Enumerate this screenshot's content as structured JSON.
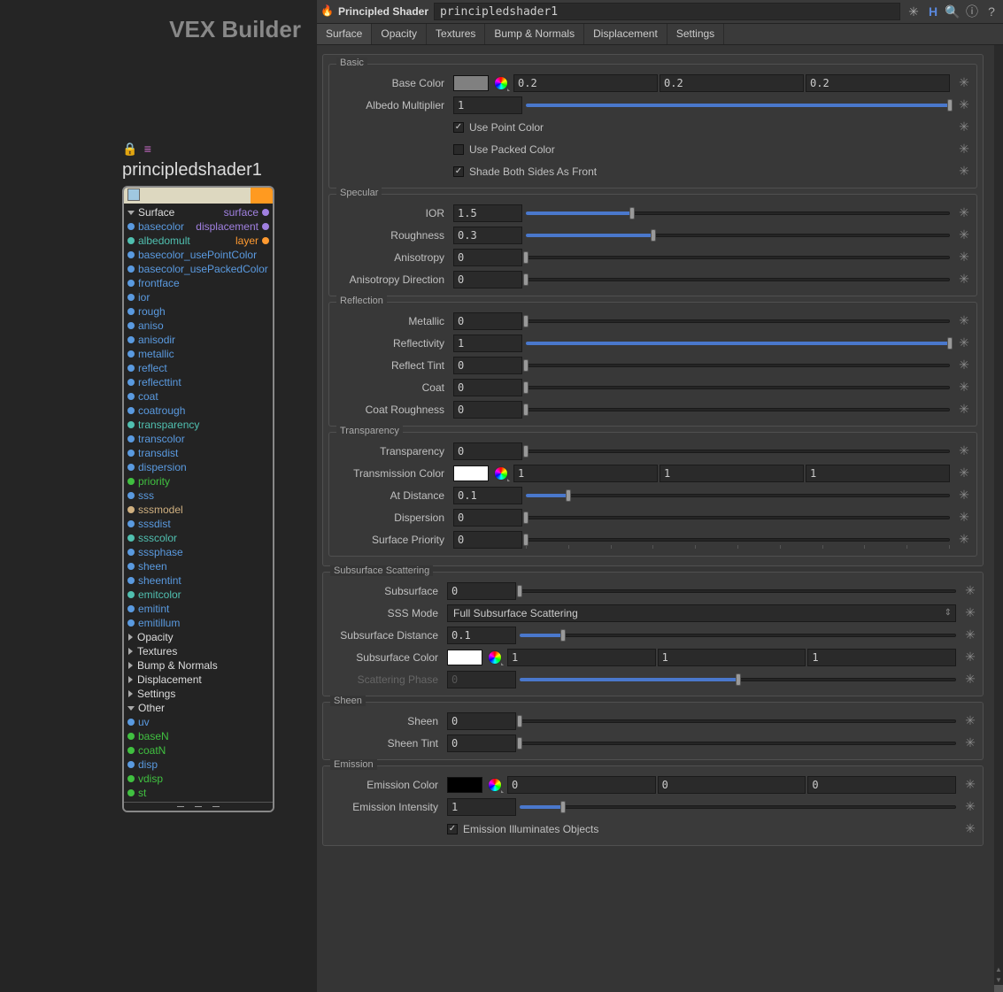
{
  "app_title": "VEX Builder",
  "node": {
    "title": "principledshader1",
    "sections": {
      "surface": "Surface",
      "opacity": "Opacity",
      "textures": "Textures",
      "bump": "Bump & Normals",
      "displacement": "Displacement",
      "settings": "Settings",
      "other": "Other"
    },
    "right_plugs": {
      "surface": "surface",
      "displacement": "displacement",
      "layer": "layer"
    },
    "params": {
      "basecolor": "basecolor",
      "albedomult": "albedomult",
      "basecolor_usePointColor": "basecolor_usePointColor",
      "basecolor_usePackedColor": "basecolor_usePackedColor",
      "frontface": "frontface",
      "ior": "ior",
      "rough": "rough",
      "aniso": "aniso",
      "anisodir": "anisodir",
      "metallic": "metallic",
      "reflect": "reflect",
      "reflecttint": "reflecttint",
      "coat": "coat",
      "coatrough": "coatrough",
      "transparency": "transparency",
      "transcolor": "transcolor",
      "transdist": "transdist",
      "dispersion": "dispersion",
      "priority": "priority",
      "sss": "sss",
      "sssmodel": "sssmodel",
      "sssdist": "sssdist",
      "ssscolor": "ssscolor",
      "sssphase": "sssphase",
      "sheen": "sheen",
      "sheentint": "sheentint",
      "emitcolor": "emitcolor",
      "emitint": "emitint",
      "emitillum": "emitillum",
      "uv": "uv",
      "baseN": "baseN",
      "coatN": "coatN",
      "disp": "disp",
      "vdisp": "vdisp",
      "st": "st"
    }
  },
  "header": {
    "type_label": "Principled Shader",
    "name_value": "principledshader1"
  },
  "tabs": [
    "Surface",
    "Opacity",
    "Textures",
    "Bump & Normals",
    "Displacement",
    "Settings"
  ],
  "groups": {
    "basic": {
      "title": "Basic",
      "base_color": {
        "label": "Base Color",
        "swatch": "#808080",
        "r": "0.2",
        "g": "0.2",
        "b": "0.2"
      },
      "albedo_mult": {
        "label": "Albedo Multiplier",
        "value": "1",
        "fill": 100
      },
      "use_point_color": {
        "label": "Use Point Color",
        "checked": true
      },
      "use_packed_color": {
        "label": "Use Packed Color",
        "checked": false
      },
      "shade_both": {
        "label": "Shade Both Sides As Front",
        "checked": true
      }
    },
    "specular": {
      "title": "Specular",
      "ior": {
        "label": "IOR",
        "value": "1.5",
        "fill": 25
      },
      "roughness": {
        "label": "Roughness",
        "value": "0.3",
        "fill": 30
      },
      "anisotropy": {
        "label": "Anisotropy",
        "value": "0",
        "fill": 0
      },
      "anisodir": {
        "label": "Anisotropy Direction",
        "value": "0",
        "fill": 0
      }
    },
    "reflection": {
      "title": "Reflection",
      "metallic": {
        "label": "Metallic",
        "value": "0",
        "fill": 0
      },
      "reflectivity": {
        "label": "Reflectivity",
        "value": "1",
        "fill": 100
      },
      "reflect_tint": {
        "label": "Reflect Tint",
        "value": "0",
        "fill": 0
      },
      "coat": {
        "label": "Coat",
        "value": "0",
        "fill": 0
      },
      "coat_rough": {
        "label": "Coat Roughness",
        "value": "0",
        "fill": 0
      }
    },
    "transparency": {
      "title": "Transparency",
      "transparency": {
        "label": "Transparency",
        "value": "0",
        "fill": 0
      },
      "trans_color": {
        "label": "Transmission Color",
        "swatch": "#ffffff",
        "r": "1",
        "g": "1",
        "b": "1"
      },
      "at_distance": {
        "label": "At Distance",
        "value": "0.1",
        "fill": 10
      },
      "dispersion": {
        "label": "Dispersion",
        "value": "0",
        "fill": 0
      },
      "priority": {
        "label": "Surface Priority",
        "value": "0",
        "fill": 0,
        "ticks": true
      }
    },
    "sss": {
      "title": "Subsurface Scattering",
      "subsurface": {
        "label": "Subsurface",
        "value": "0",
        "fill": 0
      },
      "sss_mode": {
        "label": "SSS Mode",
        "value": "Full Subsurface Scattering"
      },
      "sss_dist": {
        "label": "Subsurface Distance",
        "value": "0.1",
        "fill": 10
      },
      "sss_color": {
        "label": "Subsurface Color",
        "swatch": "#ffffff",
        "r": "1",
        "g": "1",
        "b": "1"
      },
      "scatter_phase": {
        "label": "Scattering Phase",
        "value": "0",
        "fill": 50,
        "disabled": true
      }
    },
    "sheen": {
      "title": "Sheen",
      "sheen": {
        "label": "Sheen",
        "value": "0",
        "fill": 0
      },
      "sheen_tint": {
        "label": "Sheen Tint",
        "value": "0",
        "fill": 0
      }
    },
    "emission": {
      "title": "Emission",
      "emit_color": {
        "label": "Emission Color",
        "swatch": "#000000",
        "r": "0",
        "g": "0",
        "b": "0"
      },
      "emit_intensity": {
        "label": "Emission Intensity",
        "value": "1",
        "fill": 10
      },
      "emit_illum": {
        "label": "Emission Illuminates Objects",
        "checked": true
      }
    }
  },
  "colors": {
    "blue": "#5a9ae0",
    "cyan": "#50c0b0",
    "green": "#40c040",
    "tan": "#d0b080",
    "purple": "#a080e0",
    "orange": "#ff9a30"
  }
}
